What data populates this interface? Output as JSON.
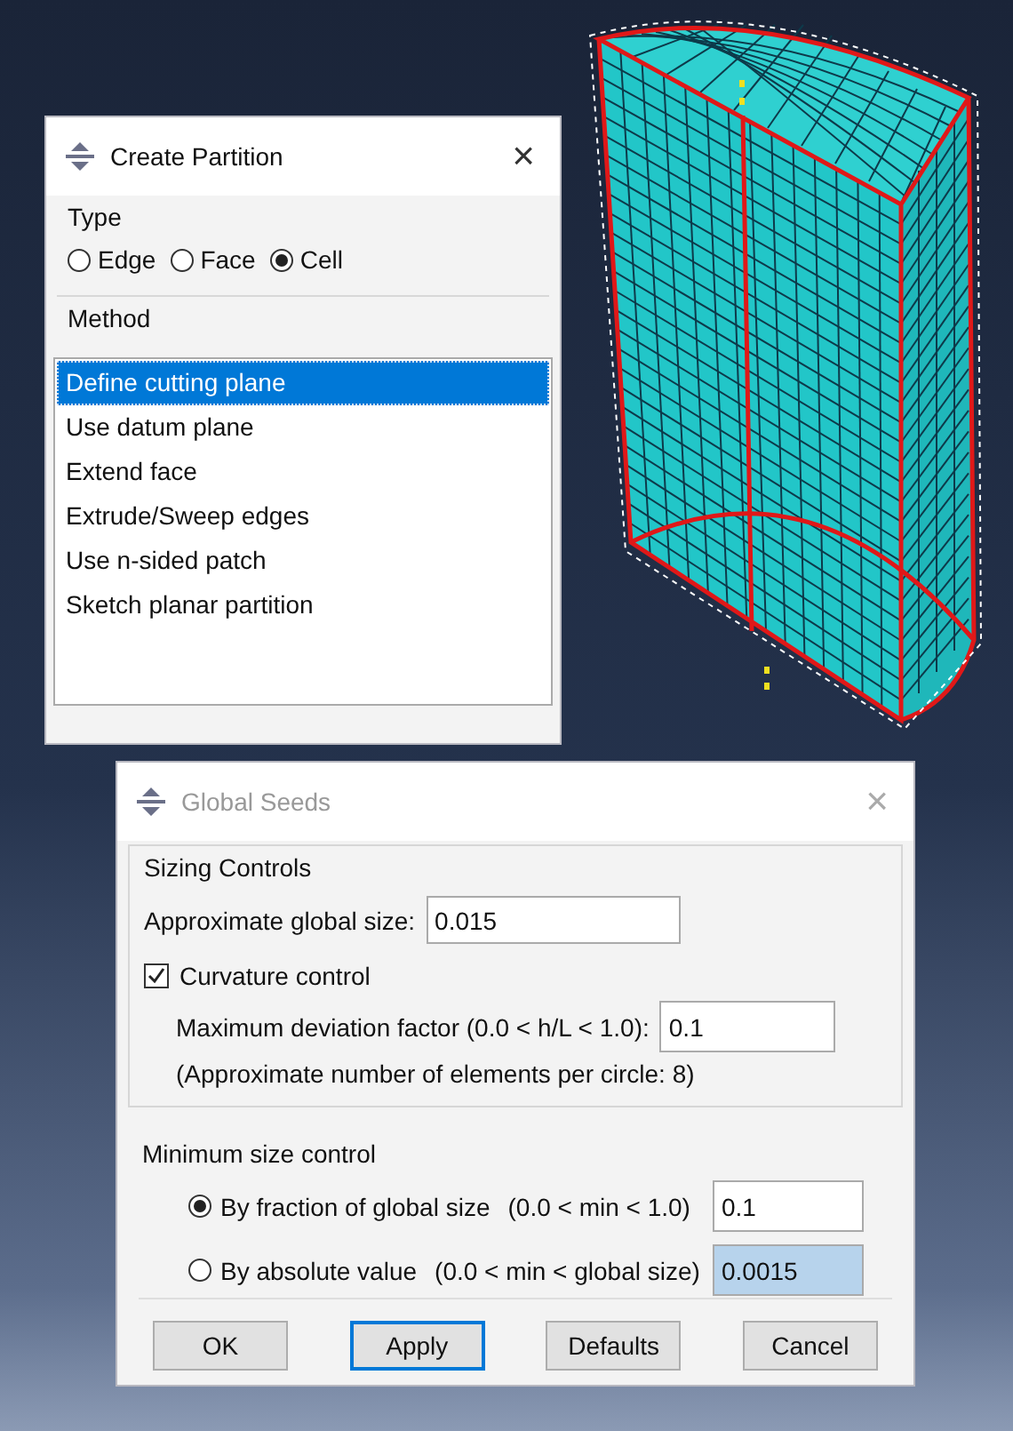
{
  "create_partition": {
    "title": "Create Partition",
    "active": true,
    "close": "×",
    "type_label": "Type",
    "type_options": [
      {
        "label": "Edge",
        "selected": false
      },
      {
        "label": "Face",
        "selected": false
      },
      {
        "label": "Cell",
        "selected": true
      }
    ],
    "method_label": "Method",
    "methods": [
      {
        "label": "Define cutting plane",
        "selected": true
      },
      {
        "label": "Use datum plane",
        "selected": false
      },
      {
        "label": "Extend face",
        "selected": false
      },
      {
        "label": "Extrude/Sweep edges",
        "selected": false
      },
      {
        "label": "Use n-sided patch",
        "selected": false
      },
      {
        "label": "Sketch planar partition",
        "selected": false
      }
    ]
  },
  "global_seeds": {
    "title": "Global Seeds",
    "active": false,
    "close": "×",
    "sizing_label": "Sizing Controls",
    "global_size": {
      "label": "Approximate global size:",
      "value": "0.015"
    },
    "curvature": {
      "label": "Curvature control",
      "checked": true
    },
    "deviation": {
      "label": "Maximum deviation factor (0.0 < h/L < 1.0):",
      "value": "0.1"
    },
    "note": "(Approximate number of elements per circle: 8)",
    "min_size_label": "Minimum size control",
    "min_options": [
      {
        "label": "By fraction of global size",
        "range": "(0.0 < min < 1.0)",
        "value": "0.1",
        "selected": true,
        "highlighted": false
      },
      {
        "label": "By absolute value",
        "range": "(0.0 < min < global size)",
        "value": "0.0015",
        "selected": false,
        "highlighted": true
      }
    ],
    "buttons": [
      {
        "label": "OK",
        "focused": false
      },
      {
        "label": "Apply",
        "focused": true
      },
      {
        "label": "Defaults",
        "focused": false
      },
      {
        "label": "Cancel",
        "focused": false
      }
    ]
  }
}
